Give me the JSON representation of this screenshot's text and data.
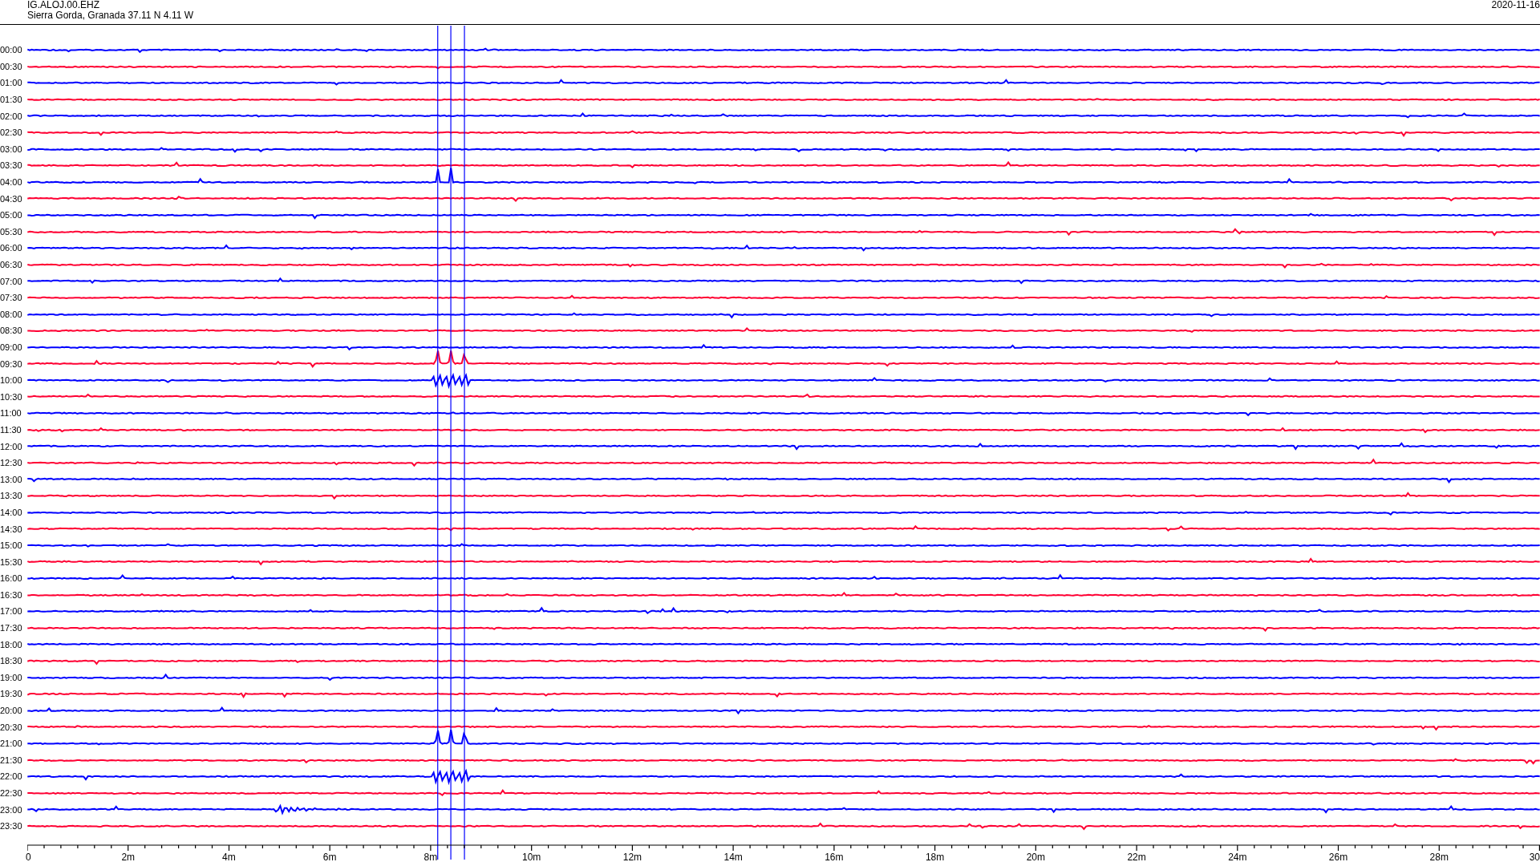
{
  "header": {
    "station": "IG.ALOJ.00.EHZ",
    "location": "Sierra Gorda, Granada  37.11 N 4.11 W",
    "date": "2020-11-16"
  },
  "traces": [
    {
      "label": "00:00",
      "color": "#0000ff"
    },
    {
      "label": "00:30",
      "color": "#ff0033"
    },
    {
      "label": "01:00",
      "color": "#0000ff"
    },
    {
      "label": "01:30",
      "color": "#ff0033"
    },
    {
      "label": "02:00",
      "color": "#0000ff"
    },
    {
      "label": "02:30",
      "color": "#ff0033"
    },
    {
      "label": "03:00",
      "color": "#0000ff"
    },
    {
      "label": "03:30",
      "color": "#ff0033"
    },
    {
      "label": "04:00",
      "color": "#0000ff"
    },
    {
      "label": "04:30",
      "color": "#ff0033"
    },
    {
      "label": "05:00",
      "color": "#0000ff"
    },
    {
      "label": "05:30",
      "color": "#ff0033"
    },
    {
      "label": "06:00",
      "color": "#0000ff"
    },
    {
      "label": "06:30",
      "color": "#ff0033"
    },
    {
      "label": "07:00",
      "color": "#0000ff"
    },
    {
      "label": "07:30",
      "color": "#ff0033"
    },
    {
      "label": "08:00",
      "color": "#0000ff"
    },
    {
      "label": "08:30",
      "color": "#ff0033"
    },
    {
      "label": "09:00",
      "color": "#0000ff"
    },
    {
      "label": "09:30",
      "color": "#ff0033"
    },
    {
      "label": "10:00",
      "color": "#0000ff"
    },
    {
      "label": "10:30",
      "color": "#ff0033"
    },
    {
      "label": "11:00",
      "color": "#0000ff"
    },
    {
      "label": "11:30",
      "color": "#ff0033"
    },
    {
      "label": "12:00",
      "color": "#0000ff"
    },
    {
      "label": "12:30",
      "color": "#ff0033"
    },
    {
      "label": "13:00",
      "color": "#0000ff"
    },
    {
      "label": "13:30",
      "color": "#ff0033"
    },
    {
      "label": "14:00",
      "color": "#0000ff"
    },
    {
      "label": "14:30",
      "color": "#ff0033"
    },
    {
      "label": "15:00",
      "color": "#0000ff"
    },
    {
      "label": "15:30",
      "color": "#ff0033"
    },
    {
      "label": "16:00",
      "color": "#0000ff"
    },
    {
      "label": "16:30",
      "color": "#ff0033"
    },
    {
      "label": "17:00",
      "color": "#0000ff"
    },
    {
      "label": "17:30",
      "color": "#ff0033"
    },
    {
      "label": "18:00",
      "color": "#0000ff"
    },
    {
      "label": "18:30",
      "color": "#ff0033"
    },
    {
      "label": "19:00",
      "color": "#0000ff"
    },
    {
      "label": "19:30",
      "color": "#ff0033"
    },
    {
      "label": "20:00",
      "color": "#0000ff"
    },
    {
      "label": "20:30",
      "color": "#ff0033"
    },
    {
      "label": "21:00",
      "color": "#0000ff"
    },
    {
      "label": "21:30",
      "color": "#ff0033"
    },
    {
      "label": "22:00",
      "color": "#0000ff"
    },
    {
      "label": "22:30",
      "color": "#ff0033"
    },
    {
      "label": "23:00",
      "color": "#0000ff"
    },
    {
      "label": "23:30",
      "color": "#ff0033"
    }
  ],
  "x_axis": {
    "ticks": [
      "0",
      "2m",
      "4m",
      "6m",
      "8m",
      "10m",
      "12m",
      "14m",
      "16m",
      "18m",
      "20m",
      "22m",
      "24m",
      "26m",
      "28m",
      "30"
    ]
  }
}
